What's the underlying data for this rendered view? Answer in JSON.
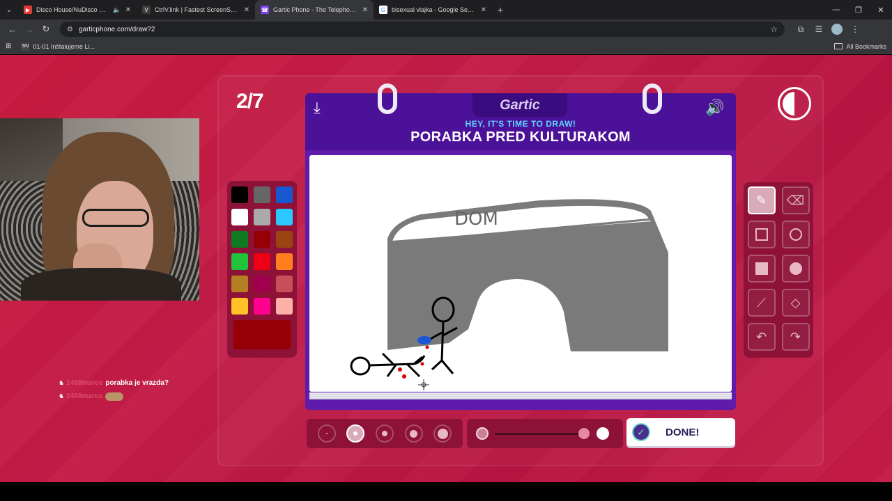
{
  "browser": {
    "tabs": [
      {
        "label": "Disco House/NuDisco Meg",
        "fav_color": "#e53935",
        "fav_glyph": "▶",
        "audio": true
      },
      {
        "label": "CtrlV.link | Fastest ScreenShot a",
        "fav_color": "#3c3c3c",
        "fav_glyph": "V",
        "audio": false
      },
      {
        "label": "Gartic Phone - The Telephone G",
        "fav_color": "#7b3ff2",
        "fav_glyph": "☎",
        "audio": false
      },
      {
        "label": "bisexual vlajka - Google Search",
        "fav_color": "#ffffff",
        "fav_glyph": "G",
        "audio": false
      }
    ],
    "url": "garticphone.com/draw?2",
    "bookmark": "01-01 Inštalujeme Li...",
    "bookmark_icon": "SN",
    "all_bookmarks": "All Bookmarks"
  },
  "game": {
    "round": "2/7",
    "logo": "Gartic",
    "subtitle": "HEY, IT'S TIME TO DRAW!",
    "prompt": "PORABKA PRED KULTURAKOM",
    "done_label": "DONE!",
    "drawing_text": "DOM"
  },
  "palette": {
    "colors": [
      "#000000",
      "#666666",
      "#1558d0",
      "#ffffff",
      "#aaaaaa",
      "#2bc8ff",
      "#0e7a22",
      "#960004",
      "#994411",
      "#20c43a",
      "#ee0014",
      "#ff7f1f",
      "#b47f24",
      "#a1004f",
      "#c84e5c",
      "#ffc126",
      "#ff008f",
      "#feb0a6"
    ],
    "selected": "#960004"
  },
  "tools": [
    {
      "name": "pen-tool-button",
      "icon": "pen-icon",
      "glyph": "✎",
      "active": true
    },
    {
      "name": "eraser-tool-button",
      "icon": "eraser-icon",
      "glyph": "⌫",
      "active": false
    },
    {
      "name": "rectangle-tool-button",
      "icon": "square-outline-icon",
      "glyph": "",
      "active": false
    },
    {
      "name": "ellipse-tool-button",
      "icon": "circle-outline-icon",
      "glyph": "",
      "active": false
    },
    {
      "name": "filled-rectangle-tool-button",
      "icon": "square-filled-icon",
      "glyph": "",
      "active": false
    },
    {
      "name": "filled-ellipse-tool-button",
      "icon": "circle-filled-icon",
      "glyph": "",
      "active": false
    },
    {
      "name": "line-tool-button",
      "icon": "line-icon",
      "glyph": "⟋",
      "active": false
    },
    {
      "name": "fill-bucket-tool-button",
      "icon": "bucket-icon",
      "glyph": "◇",
      "active": false
    },
    {
      "name": "undo-button",
      "icon": "undo-icon",
      "glyph": "↶",
      "active": false
    },
    {
      "name": "redo-button",
      "icon": "redo-icon",
      "glyph": "↷",
      "active": false
    }
  ],
  "brush_sizes": [
    {
      "size": 2,
      "active": false
    },
    {
      "size": 6,
      "active": true
    },
    {
      "size": 8,
      "active": false
    },
    {
      "size": 11,
      "active": false
    },
    {
      "size": 15,
      "active": false
    }
  ],
  "chat": [
    {
      "user": "1488maros",
      "message": "porabka je vrazda?",
      "emote": false
    },
    {
      "user": "1488maros",
      "message": "",
      "emote": true
    }
  ]
}
